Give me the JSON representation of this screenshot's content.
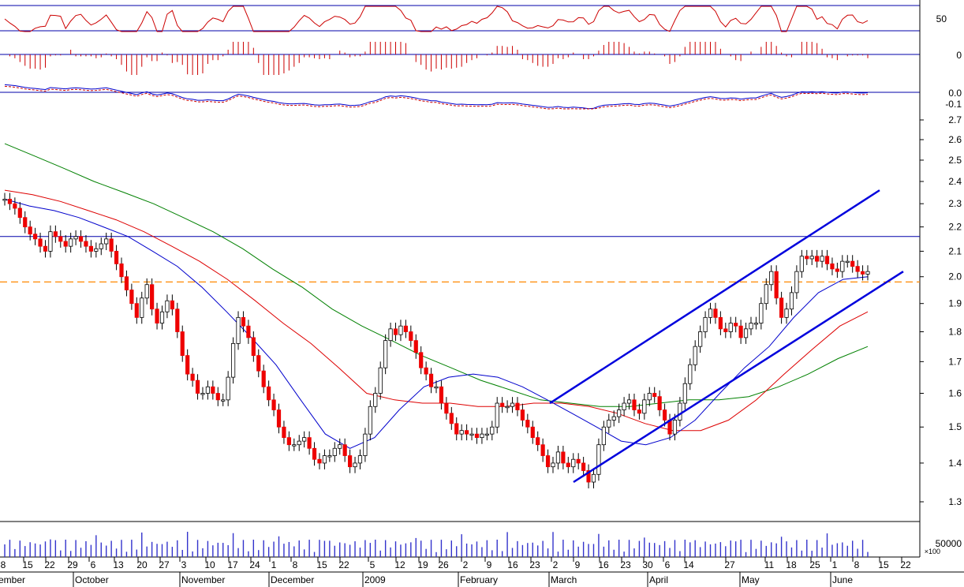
{
  "chart_data": {
    "type": "candlestick",
    "title": "",
    "xlabel": "",
    "ylabel": "",
    "price_axis": {
      "ticks": [
        "1.3",
        "1.4",
        "1.5",
        "1.6",
        "1.7",
        "1.8",
        "1.9",
        "2.0",
        "2.1",
        "2.2",
        "2.3",
        "2.4",
        "2.5",
        "2.6",
        "2.7"
      ],
      "ylim": [
        1.25,
        2.73
      ],
      "scale": "log"
    },
    "upper_panel_ticks": {
      "rsi": [
        "50"
      ],
      "hist": [
        "0"
      ],
      "macd": [
        "0.0",
        "-0.1"
      ]
    },
    "volume_axis": {
      "tick": "50000",
      "multiplier": "×100"
    },
    "x_tick_labels": [
      "8",
      "15",
      "22",
      "29",
      "6",
      "13",
      "20",
      "27",
      "3",
      "10",
      "17",
      "24",
      "1",
      "8",
      "15",
      "22",
      "5",
      "12",
      "19",
      "26",
      "2",
      "9",
      "16",
      "23",
      "2",
      "9",
      "16",
      "23",
      "30",
      "6",
      "14",
      "27",
      "11",
      "18",
      "25",
      "1",
      "8",
      "15",
      "22"
    ],
    "month_labels": [
      "ember",
      "October",
      "November",
      "December",
      "2009",
      "February",
      "March",
      "April",
      "May",
      "June"
    ],
    "reference_lines": {
      "resistance": 2.16,
      "dashed_support": 1.98
    },
    "closes": [
      2.32,
      2.3,
      2.28,
      2.24,
      2.2,
      2.17,
      2.15,
      2.12,
      2.1,
      2.18,
      2.16,
      2.14,
      2.12,
      2.15,
      2.16,
      2.14,
      2.12,
      2.1,
      2.11,
      2.13,
      2.15,
      2.1,
      2.05,
      2.0,
      1.95,
      1.9,
      1.85,
      1.92,
      1.97,
      1.88,
      1.83,
      1.87,
      1.91,
      1.88,
      1.8,
      1.72,
      1.66,
      1.64,
      1.6,
      1.6,
      1.62,
      1.6,
      1.58,
      1.58,
      1.65,
      1.76,
      1.85,
      1.82,
      1.78,
      1.72,
      1.67,
      1.62,
      1.58,
      1.55,
      1.5,
      1.47,
      1.45,
      1.45,
      1.46,
      1.47,
      1.44,
      1.41,
      1.4,
      1.42,
      1.42,
      1.44,
      1.45,
      1.42,
      1.39,
      1.4,
      1.42,
      1.48,
      1.56,
      1.6,
      1.68,
      1.77,
      1.81,
      1.79,
      1.82,
      1.8,
      1.77,
      1.73,
      1.68,
      1.66,
      1.62,
      1.62,
      1.57,
      1.54,
      1.51,
      1.48,
      1.49,
      1.48,
      1.48,
      1.47,
      1.48,
      1.48,
      1.5,
      1.57,
      1.56,
      1.56,
      1.57,
      1.55,
      1.52,
      1.5,
      1.47,
      1.45,
      1.42,
      1.39,
      1.4,
      1.43,
      1.4,
      1.39,
      1.41,
      1.4,
      1.38,
      1.35,
      1.37,
      1.45,
      1.5,
      1.52,
      1.53,
      1.55,
      1.57,
      1.58,
      1.55,
      1.54,
      1.58,
      1.6,
      1.59,
      1.55,
      1.52,
      1.48,
      1.52,
      1.57,
      1.63,
      1.69,
      1.75,
      1.8,
      1.85,
      1.88,
      1.85,
      1.81,
      1.8,
      1.83,
      1.82,
      1.78,
      1.81,
      1.83,
      1.83,
      1.9,
      1.97,
      2.02,
      1.92,
      1.85,
      1.88,
      1.94,
      2.02,
      2.08,
      2.07,
      2.08,
      2.06,
      2.08,
      2.05,
      2.03,
      2.02,
      2.06,
      2.06,
      2.04,
      2.02,
      2.01,
      2.02
    ],
    "ma_short_blue": [
      2.32,
      2.29,
      2.27,
      2.24,
      2.2,
      2.16,
      2.1,
      2.04,
      1.96,
      1.87,
      1.78,
      1.69,
      1.58,
      1.48,
      1.44,
      1.47,
      1.55,
      1.62,
      1.65,
      1.66,
      1.65,
      1.62,
      1.58,
      1.54,
      1.5,
      1.46,
      1.45,
      1.47,
      1.52,
      1.6,
      1.68,
      1.75,
      1.85,
      1.94,
      1.99,
      2.0
    ],
    "ma_mid_red": [
      2.36,
      2.34,
      2.31,
      2.27,
      2.23,
      2.18,
      2.12,
      2.06,
      1.99,
      1.91,
      1.83,
      1.76,
      1.68,
      1.6,
      1.58,
      1.57,
      1.57,
      1.56,
      1.56,
      1.57,
      1.57,
      1.56,
      1.54,
      1.51,
      1.49,
      1.49,
      1.52,
      1.58,
      1.66,
      1.74,
      1.82,
      1.87
    ],
    "ma_long_green": [
      2.58,
      2.52,
      2.46,
      2.4,
      2.35,
      2.3,
      2.24,
      2.18,
      2.11,
      2.03,
      1.96,
      1.88,
      1.82,
      1.77,
      1.72,
      1.68,
      1.64,
      1.61,
      1.58,
      1.57,
      1.56,
      1.56,
      1.57,
      1.58,
      1.58,
      1.59,
      1.62,
      1.66,
      1.71,
      1.75
    ],
    "channel": {
      "upper": {
        "start": [
          0,
          1.57
        ],
        "end": [
          1,
          2.36
        ]
      },
      "lower": {
        "start": [
          0,
          1.35
        ],
        "end": [
          1,
          2.02
        ]
      }
    }
  }
}
